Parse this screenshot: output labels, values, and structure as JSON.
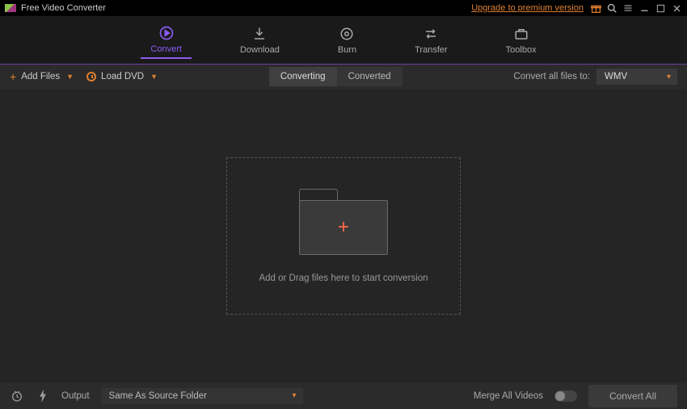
{
  "titlebar": {
    "app_title": "Free Video Converter",
    "upgrade_link": "Upgrade to premium version"
  },
  "main_tabs": {
    "convert": "Convert",
    "download": "Download",
    "burn": "Burn",
    "transfer": "Transfer",
    "toolbox": "Toolbox"
  },
  "toolbar": {
    "add_files": "Add Files",
    "load_dvd": "Load DVD",
    "subtabs": {
      "converting": "Converting",
      "converted": "Converted"
    },
    "convert_to_label": "Convert all files to:",
    "format_value": "WMV"
  },
  "dropzone": {
    "text": "Add or Drag files here to start conversion"
  },
  "footer": {
    "output_label": "Output",
    "output_value": "Same As Source Folder",
    "merge_label": "Merge All Videos",
    "convert_all": "Convert All"
  }
}
